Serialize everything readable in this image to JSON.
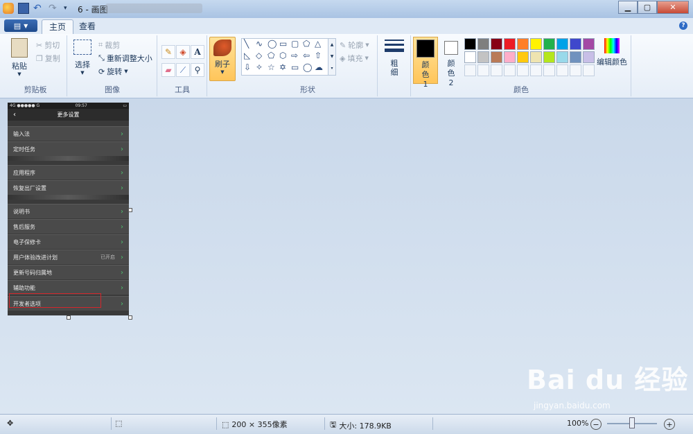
{
  "window": {
    "title": "6 - 画图"
  },
  "tabs": [
    {
      "label": "主页"
    },
    {
      "label": "查看"
    }
  ],
  "clipboard": {
    "paste": "粘贴",
    "cut": "剪切",
    "copy": "复制",
    "group": "剪贴板"
  },
  "image": {
    "select": "选择",
    "crop": "裁剪",
    "resize": "重新调整大小",
    "rotate": "旋转",
    "group": "图像"
  },
  "tools": {
    "group": "工具"
  },
  "brush": {
    "label": "刷子"
  },
  "shapes": {
    "outline": "轮廓",
    "fill": "填充",
    "group": "形状"
  },
  "size": {
    "label": "粗细"
  },
  "colors": {
    "color1": "颜色 1",
    "color2": "颜色 2",
    "edit": "编辑颜色",
    "group": "颜色",
    "palette_row1": [
      "#000000",
      "#7f7f7f",
      "#880015",
      "#ed1c24",
      "#ff7f27",
      "#fff200",
      "#22b14c",
      "#00a2e8",
      "#3f48cc",
      "#a349a4"
    ],
    "palette_row2": [
      "#ffffff",
      "#c3c3c3",
      "#b97a57",
      "#ffaec9",
      "#ffc90e",
      "#efe4b0",
      "#b5e61d",
      "#99d9ea",
      "#7092be",
      "#c8bfe7"
    ]
  },
  "phone": {
    "time": "09:57",
    "signal": "4G ●●●●● G",
    "title": "更多设置",
    "rows": [
      {
        "label": "输入法",
        "value": ""
      },
      {
        "label": "定时任务",
        "value": ""
      },
      {
        "label": "应用程序",
        "value": ""
      },
      {
        "label": "恢复出厂设置",
        "value": ""
      },
      {
        "label": "说明书",
        "value": ""
      },
      {
        "label": "售后服务",
        "value": ""
      },
      {
        "label": "电子保修卡",
        "value": ""
      },
      {
        "label": "用户体验改进计划",
        "value": "已开启"
      },
      {
        "label": "更新号码归属地",
        "value": ""
      },
      {
        "label": "辅助功能",
        "value": ""
      },
      {
        "label": "开发者选项",
        "value": ""
      }
    ]
  },
  "statusbar": {
    "dimensions": "200 × 355像素",
    "size": "大小: 178.9KB",
    "zoom": "100%"
  },
  "watermark": {
    "logo": "Bai du 经验",
    "url": "jingyan.baidu.com"
  }
}
